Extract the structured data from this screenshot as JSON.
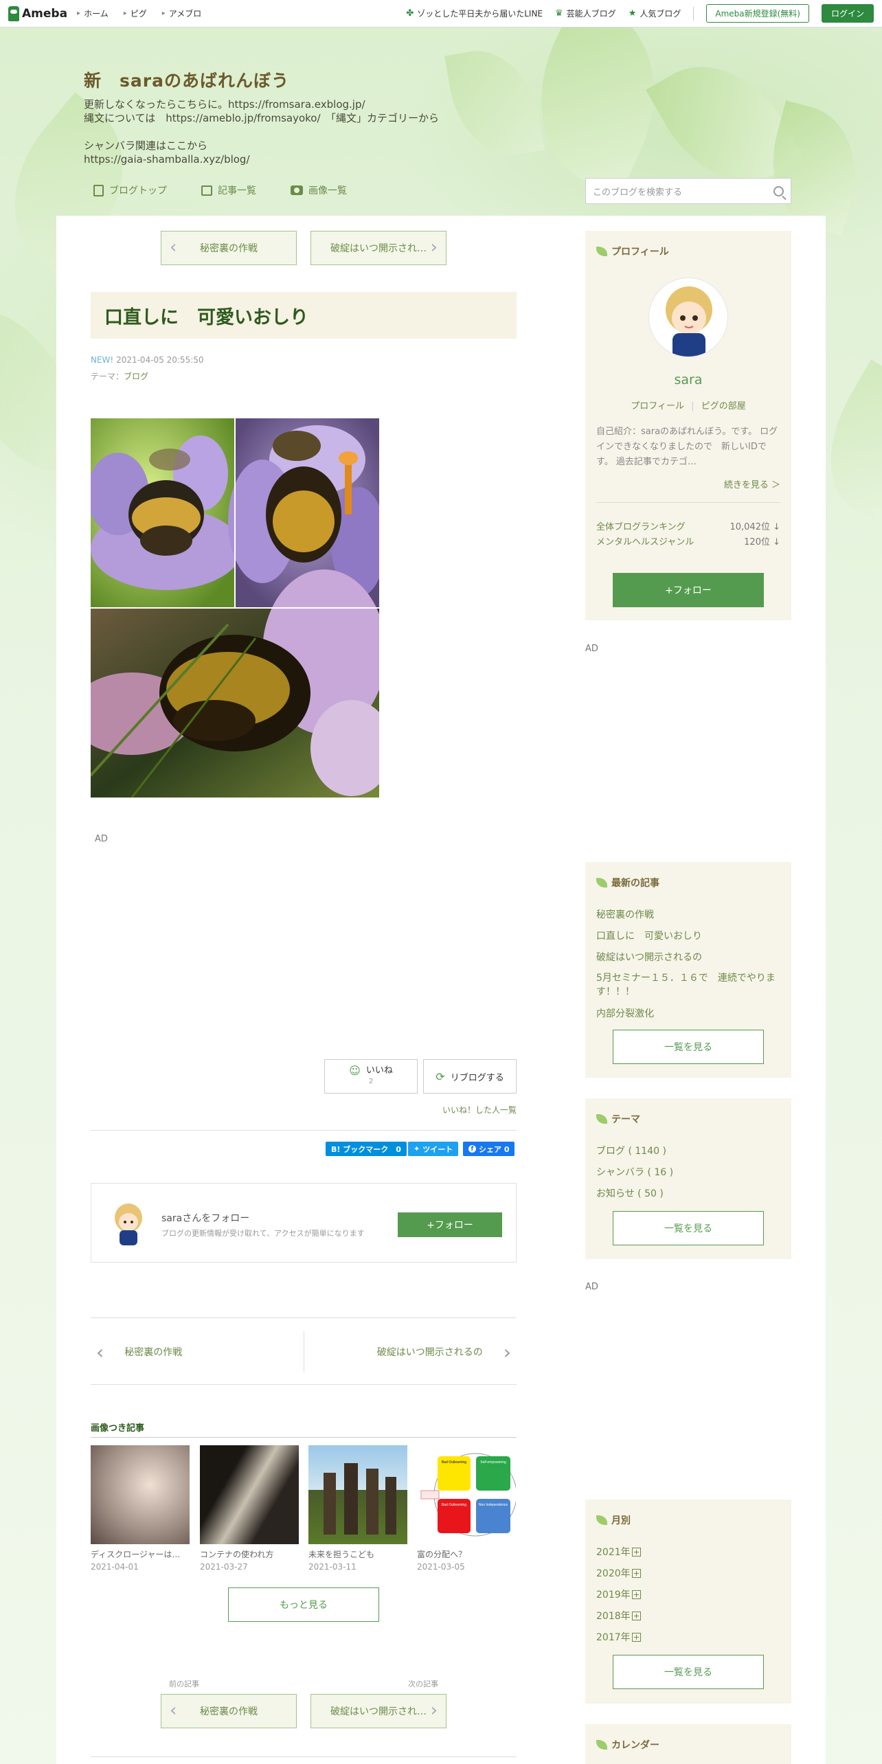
{
  "topbar": {
    "logo": "Ameba",
    "nav": [
      "ホーム",
      "ピグ",
      "アメブロ"
    ],
    "links": [
      {
        "icon": "clover-icon",
        "label": "ゾッとした平日夫から届いたLINE"
      },
      {
        "icon": "crown-icon",
        "label": "芸能人ブログ"
      },
      {
        "icon": "star-icon",
        "label": "人気ブログ"
      }
    ],
    "register": "Ameba新規登録(無料)",
    "login": "ログイン"
  },
  "header": {
    "title": "新　saraのあばれんぼう",
    "desc": "更新しなくなったらこちらに。https://fromsara.exblog.jp/\n縄文については　https://ameblo.jp/fromsayoko/　「縄文」カテゴリーから\n\nシャンバラ関連はここから\nhttps://gaia-shamballa.xyz/blog/",
    "nav": [
      "ブログトップ",
      "記事一覧",
      "画像一覧"
    ],
    "search_placeholder": "このブログを検索する"
  },
  "article": {
    "prev": "秘密裏の作戦",
    "next": "破綻はいつ開示され…",
    "title": "口直しに　可愛いおしり",
    "new_label": "NEW!",
    "date": "2021-04-05 20:55:50",
    "theme_label": "テーマ：",
    "theme": "ブログ",
    "ad": "AD",
    "like": "いいね",
    "like_count": "2",
    "reblog": "リブログする",
    "liked_list": "いいね！した人一覧",
    "hatena": "B! ブックマーク　0",
    "tweet": "ツイート",
    "share": "シェア 0"
  },
  "follow": {
    "title": "saraさんをフォロー",
    "desc": "ブログの更新情報が受け取れて、アクセスが簡単になります",
    "button": "+フォロー"
  },
  "prevnext": {
    "prev": "秘密裏の作戦",
    "next": "破綻はいつ開示されるの"
  },
  "image_articles": {
    "heading": "画像つき記事",
    "items": [
      {
        "title": "ディスクロージャーは…",
        "date": "2021-04-01"
      },
      {
        "title": "コンテナの使われ方",
        "date": "2021-03-27"
      },
      {
        "title": "未来を担うこども",
        "date": "2021-03-11"
      },
      {
        "title": "富の分配へ？",
        "date": "2021-03-05"
      }
    ],
    "more": "もっと見る"
  },
  "bottom_nav": {
    "prev_label": "前の記事",
    "next_label": "次の記事",
    "prev": "秘密裏の作戦",
    "next": "破綻はいつ開示され…"
  },
  "sidebar": {
    "profile": {
      "heading": "プロフィール",
      "name": "sara",
      "link1": "プロフィール",
      "link2": "ピグの部屋",
      "intro": "自己紹介：saraのあばれんぼう。です。 ログインできなくなりましたので　新しいIDです。 過去記事でカテゴ…",
      "more": "続きを見る ＞",
      "rank1_label": "全体ブログランキング",
      "rank1": "10,042位 ↓",
      "rank2_label": "メンタルヘルスジャンル",
      "rank2": "120位 ↓",
      "follow": "+フォロー"
    },
    "ad1": "AD",
    "latest": {
      "heading": "最新の記事",
      "items": [
        "秘密裏の作戦",
        "口直しに　可愛いおしり",
        "破綻はいつ開示されるの",
        "5月セミナー１５．１６で　連続でやります！！！",
        "内部分裂激化"
      ],
      "more": "一覧を見る"
    },
    "theme": {
      "heading": "テーマ",
      "items": [
        "ブログ ( 1140 )",
        "シャンバラ ( 16 )",
        "お知らせ ( 50 )"
      ],
      "more": "一覧を見る"
    },
    "ad2": "AD",
    "monthly": {
      "heading": "月別",
      "items": [
        "2021年",
        "2020年",
        "2019年",
        "2018年",
        "2017年"
      ],
      "more": "一覧を見る"
    },
    "calendar": {
      "heading": "カレンダー"
    }
  },
  "infographic": {
    "labels": [
      "Bad Outlearning",
      "Self-empowering",
      "Bad Outlearning",
      "Neo Independence"
    ]
  }
}
